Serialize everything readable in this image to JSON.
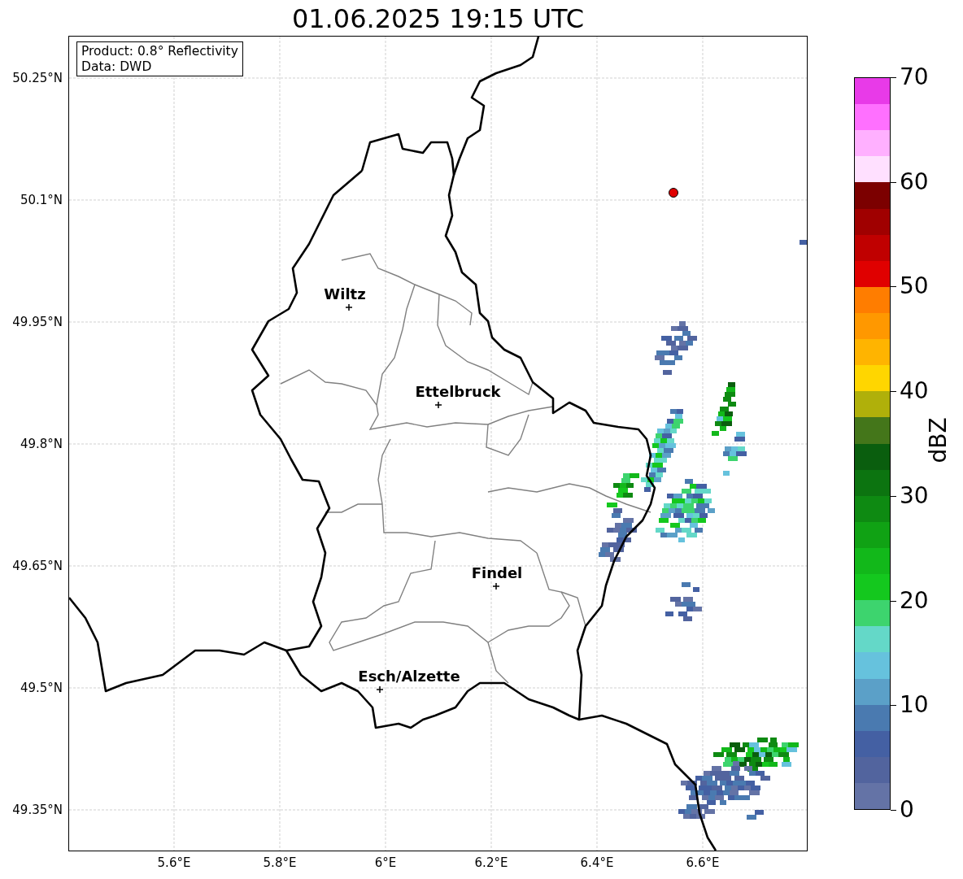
{
  "title": "01.06.2025 19:15 UTC",
  "info_box": {
    "lines": [
      "Product: 0.8° Reflectivity",
      "Data: DWD"
    ]
  },
  "map": {
    "lat_ticks": [
      "50.25°N",
      "50.1°N",
      "49.95°N",
      "49.8°N",
      "49.65°N",
      "49.5°N",
      "49.35°N"
    ],
    "lon_ticks": [
      "5.6°E",
      "5.8°E",
      "6°E",
      "6.2°E",
      "6.4°E",
      "6.6°E"
    ],
    "cities": [
      {
        "name": "Wiltz"
      },
      {
        "name": "Ettelbruck"
      },
      {
        "name": "Findel"
      },
      {
        "name": "Esch/Alzette"
      }
    ]
  },
  "colorbar": {
    "label": "dBZ",
    "ticks": [
      "70",
      "60",
      "50",
      "40",
      "30",
      "20",
      "10",
      "0"
    ],
    "segments": [
      {
        "color": "#e83ae8"
      },
      {
        "color": "#ff70ff"
      },
      {
        "color": "#ffb0ff"
      },
      {
        "color": "#ffe0ff"
      },
      {
        "color": "#7c0000"
      },
      {
        "color": "#a00000"
      },
      {
        "color": "#c00000"
      },
      {
        "color": "#e00000"
      },
      {
        "color": "#ff7d00"
      },
      {
        "color": "#ff9800"
      },
      {
        "color": "#ffb400"
      },
      {
        "color": "#ffd600"
      },
      {
        "color": "#b0b00a"
      },
      {
        "color": "#44761a"
      },
      {
        "color": "#0a5e0e"
      },
      {
        "color": "#0c7410"
      },
      {
        "color": "#0e8a12"
      },
      {
        "color": "#10a214"
      },
      {
        "color": "#12b81a"
      },
      {
        "color": "#14c81e"
      },
      {
        "color": "#3dd46e"
      },
      {
        "color": "#64d8c8"
      },
      {
        "color": "#66c2dd"
      },
      {
        "color": "#5ba0c8"
      },
      {
        "color": "#4a7ab0"
      },
      {
        "color": "#4460a3"
      },
      {
        "color": "#52649e"
      },
      {
        "color": "#6473a6"
      }
    ]
  }
}
